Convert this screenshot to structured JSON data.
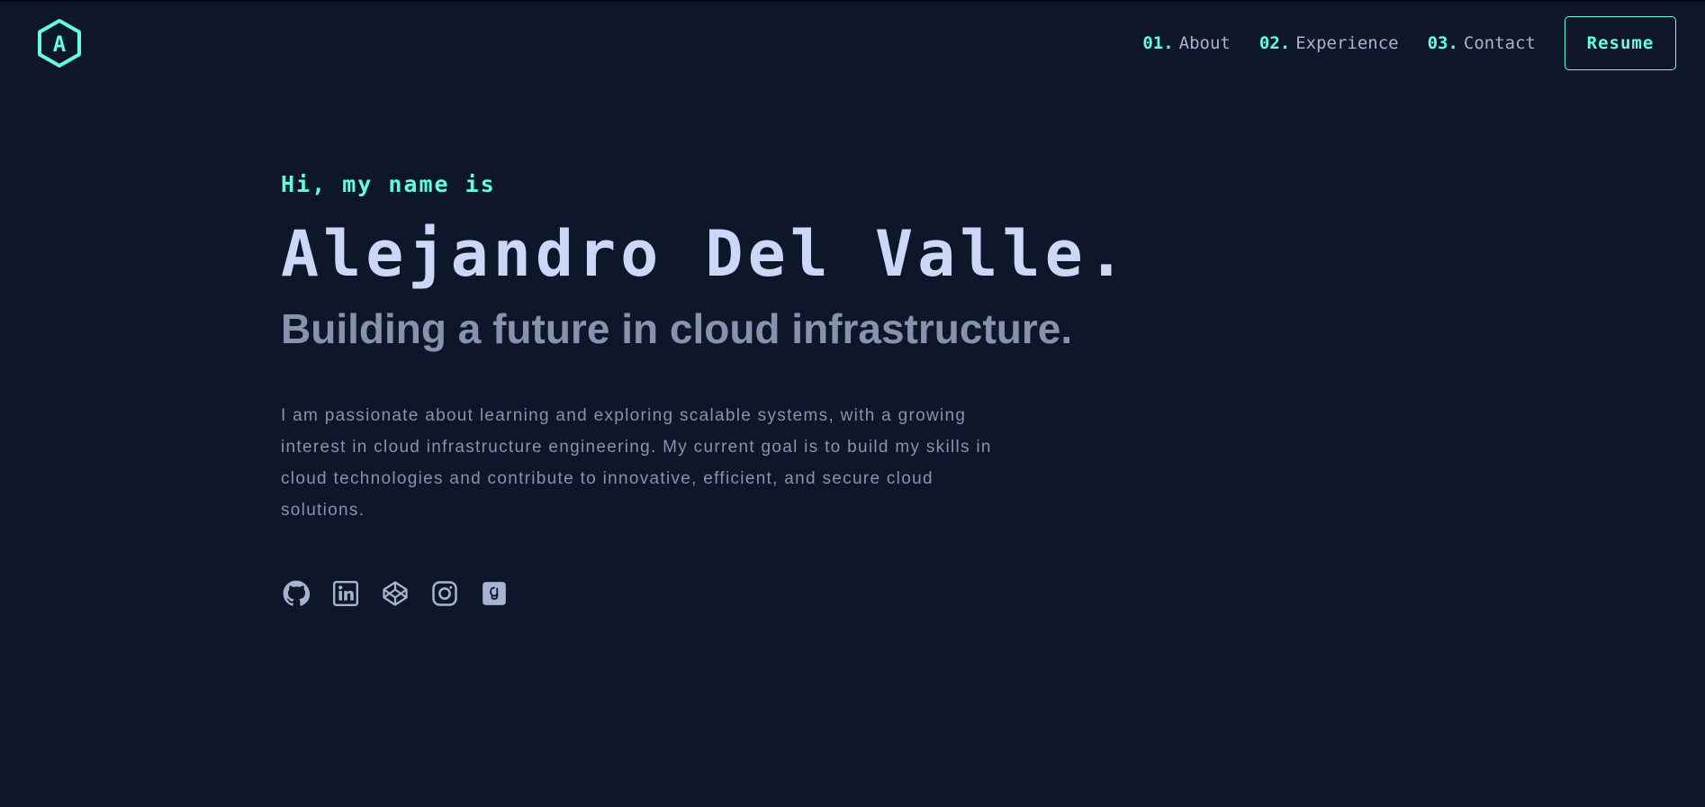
{
  "colors": {
    "background": "#0e1729",
    "accent": "#64ffda",
    "heading": "#ccd6f6",
    "muted": "#8892b0",
    "nav_text": "#a8b2d1"
  },
  "logo": {
    "letter": "A",
    "icon": "hexagon-logo-icon"
  },
  "nav": {
    "items": [
      {
        "num": "01.",
        "label": "About"
      },
      {
        "num": "02.",
        "label": "Experience"
      },
      {
        "num": "03.",
        "label": "Contact"
      }
    ],
    "resume_label": "Resume"
  },
  "hero": {
    "greeting": "Hi, my name is",
    "name": "Alejandro Del Valle.",
    "tagline": "Building a future in cloud infrastructure.",
    "bio": "I am passionate about learning and exploring scalable systems, with a growing interest in cloud infrastructure engineering. My current goal is to build my skills in cloud technologies and contribute to innovative, efficient, and secure cloud solutions."
  },
  "socials": [
    {
      "icon": "github-icon"
    },
    {
      "icon": "linkedin-icon"
    },
    {
      "icon": "codepen-icon"
    },
    {
      "icon": "instagram-icon"
    },
    {
      "icon": "goodreads-icon"
    }
  ]
}
